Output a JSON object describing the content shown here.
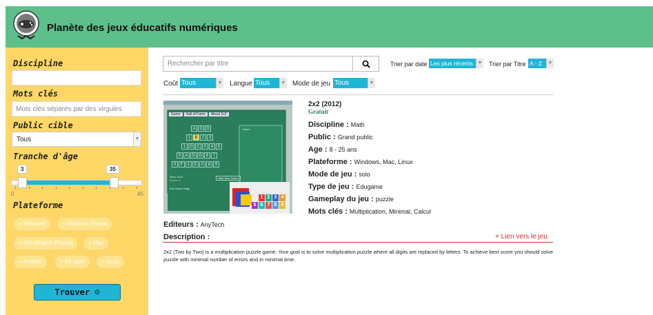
{
  "header": {
    "title": "Planète des jeux éducatifs numériques",
    "bg_color": "#5dc08a"
  },
  "sidebar": {
    "discipline_label": "Discipline",
    "discipline_value": "",
    "keywords_label": "Mots clés",
    "keywords_placeholder": "Mots clés séparés par des virgules",
    "public_label": "Public cible",
    "public_value": "Tous",
    "age_label": "Tranche d'âge",
    "age_low": "3",
    "age_high": "35",
    "age_min": "0",
    "age_max": "45",
    "age_range": {
      "min": 0,
      "max": 45,
      "low": 3,
      "high": 35
    },
    "platform_label": "Plateforme",
    "platforms": [
      "+ Windows",
      "+ Windows Phone",
      "+ iOS (iPad & iPhone)",
      "+ Mac",
      "+ Android",
      "+ En ligne",
      "+ Linux"
    ],
    "find_label": "Trouver ☺",
    "bg_color": "#fed767"
  },
  "search": {
    "placeholder": "Rechercher par titre"
  },
  "sort": {
    "date_label": "Trier par date",
    "date_value": "Les plus récents",
    "title_label": "Trier par Titre",
    "title_value": "A - Z"
  },
  "filters": {
    "cost_label": "Coût",
    "cost_value": "Tous",
    "lang_label": "Langue",
    "lang_value": "Tous",
    "mode_label": "Mode de jeu",
    "mode_value": "Tous"
  },
  "game": {
    "title": "2x2 (2012)",
    "price": "Gratuit",
    "discipline_label": "Discipline :",
    "discipline": "Math",
    "public_label": "Public :",
    "public": "Grand public",
    "age_label": "Age :",
    "age": "8 - 25 ans",
    "platform_label": "Plateforme :",
    "platform": "Windows, Mac, Linux",
    "mode_label": "Mode de jeu :",
    "mode": "solo",
    "type_label": "Type de jeu :",
    "type": "Edugame",
    "gameplay_label": "Gameplay du jeu :",
    "gameplay": "puzzle",
    "keywords_label": "Mots clés :",
    "keywords": "Multiplication, Minimal, Calcul",
    "editors_label": "Editeurs :",
    "editors": "AnyTech",
    "description_label": "Description :",
    "link_label": "+ Lien vers le jeu",
    "description": "2x2 (Two by Two) is a multiplication puzzle game. Your goal is to solve multiplication puzzle where all digits are replaced by letters. To achieve best score you should solve puzzle with minimal number of errors and in minimal time.",
    "screenshot": {
      "tabs": [
        "Game",
        "Hall of Fame",
        "About 2x2"
      ],
      "grid_rows": [
        [
          "A",
          "D",
          "G"
        ],
        [
          "1",
          "B",
          "2",
          "3"
        ],
        [
          "1",
          "G",
          "C",
          "0",
          "4",
          "5"
        ],
        [
          "0",
          "A",
          "D",
          "G",
          "6",
          "7"
        ],
        [
          "0",
          "F",
          "1",
          "E",
          "0",
          "8",
          "9"
        ]
      ],
      "time_text": "Time: 0:40",
      "errors_text": "Errors: 1",
      "new_game_label": "Start New Game",
      "exit_label": "Exit Game Page",
      "notes_label": "Notes",
      "block_rows": [
        [
          "1",
          "2",
          "3",
          "4"
        ],
        [
          "5",
          "6",
          "7",
          "8",
          "9"
        ]
      ]
    }
  },
  "colors": {
    "accent": "#1fb6d6",
    "link": "#d32f2f"
  }
}
